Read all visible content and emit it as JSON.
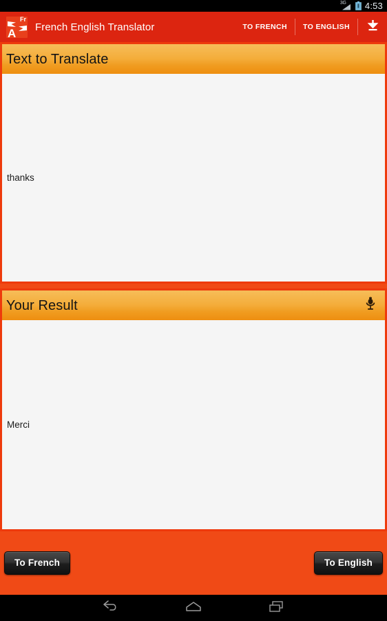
{
  "statusbar": {
    "network_label": "3G",
    "signal_icon": "signal-bars-icon",
    "battery_icon": "battery-icon",
    "time": "4:53"
  },
  "actionbar": {
    "app_icon": "app-logo-icon",
    "app_icon_letter": "A",
    "app_icon_lang": "Fr",
    "title": "French English Translator",
    "to_french_label": "TO FRENCH",
    "to_english_label": "TO ENGLISH",
    "download_icon": "download-icon"
  },
  "input_panel": {
    "header": "Text to Translate",
    "text": "thanks"
  },
  "result_panel": {
    "header": "Your Result",
    "mic_icon": "microphone-icon",
    "text": "Merci"
  },
  "footer": {
    "to_french_label": "To French",
    "to_english_label": "To English"
  },
  "navbar": {
    "back_icon": "back-arrow-icon",
    "home_icon": "home-icon",
    "recents_icon": "recent-apps-icon"
  },
  "colors": {
    "actionbar_red": "#DC2510",
    "background_orange": "#F04A16",
    "panel_border": "#EE3A0C",
    "header_gradient_top": "#F6BD59",
    "header_gradient_bottom": "#EE8E10",
    "panel_body": "#F5F5F5",
    "button_dark": "#1d1d1d"
  }
}
